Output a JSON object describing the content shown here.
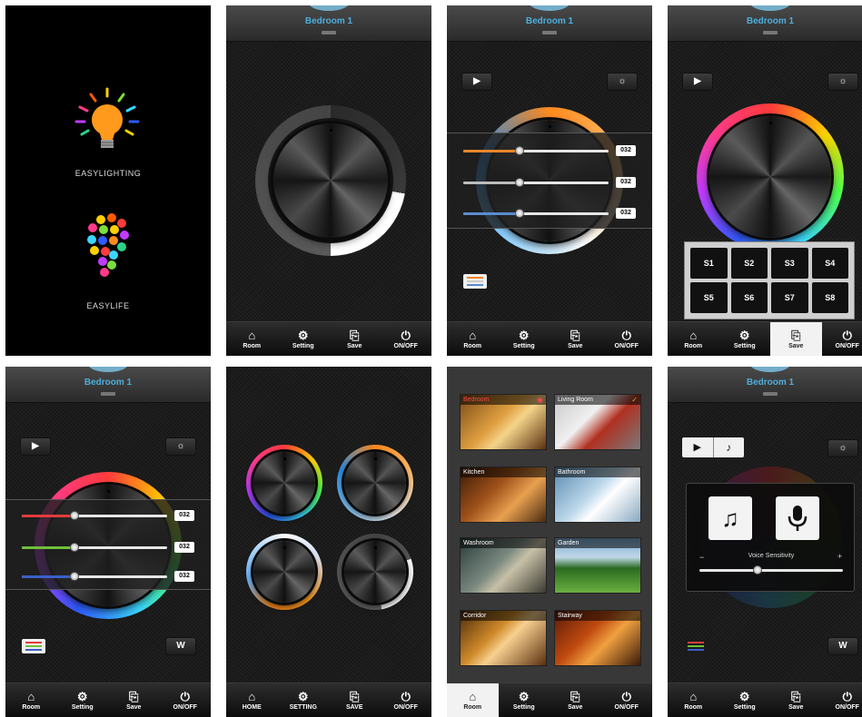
{
  "splash": {
    "easylighting_label": "EASYLIGHTING",
    "easylife_label": "EASYLIFE"
  },
  "header": {
    "title": "Bedroom 1"
  },
  "tabs_standard": [
    {
      "label": "Room",
      "icon": "home-icon"
    },
    {
      "label": "Setting",
      "icon": "gear-icon"
    },
    {
      "label": "Save",
      "icon": "save-icon"
    },
    {
      "label": "ON/OFF",
      "icon": "power-icon"
    }
  ],
  "tabs_upper": [
    {
      "label": "HOME",
      "icon": "home-icon"
    },
    {
      "label": "SETTING",
      "icon": "gear-icon"
    },
    {
      "label": "SAVE",
      "icon": "save-icon"
    },
    {
      "label": "ON/OFF",
      "icon": "power-icon"
    }
  ],
  "sliders": {
    "warm_white": [
      {
        "color": "#e8862a",
        "value": 0.38,
        "readout": "032"
      },
      {
        "color": "#bdbdbd",
        "value": 0.38,
        "readout": "032"
      },
      {
        "color": "#5a8ccf",
        "value": 0.38,
        "readout": "032"
      }
    ],
    "rgb": [
      {
        "color": "#e33b3b",
        "value": 0.35,
        "readout": "032"
      },
      {
        "color": "#6fbf3a",
        "value": 0.35,
        "readout": "032"
      },
      {
        "color": "#3b5fc8",
        "value": 0.35,
        "readout": "032"
      }
    ]
  },
  "scenes": [
    "S1",
    "S2",
    "S3",
    "S4",
    "S5",
    "S6",
    "S7",
    "S8"
  ],
  "white_button_label": "W",
  "rooms": [
    {
      "name": "Bedroom",
      "selected": true
    },
    {
      "name": "Living Room",
      "selected": false
    },
    {
      "name": "Kitchen",
      "selected": false
    },
    {
      "name": "Bathroom",
      "selected": false
    },
    {
      "name": "Washroom",
      "selected": false
    },
    {
      "name": "Garden",
      "selected": false
    },
    {
      "name": "Corridor",
      "selected": false
    },
    {
      "name": "Stairway",
      "selected": false
    }
  ],
  "music": {
    "sensitivity_label": "Voice Sensitivity",
    "minus": "−",
    "plus": "+",
    "sensitivity_value": 0.4
  },
  "colors": {
    "header_title": "#4eaedd",
    "accent_orange": "#e8862a"
  }
}
